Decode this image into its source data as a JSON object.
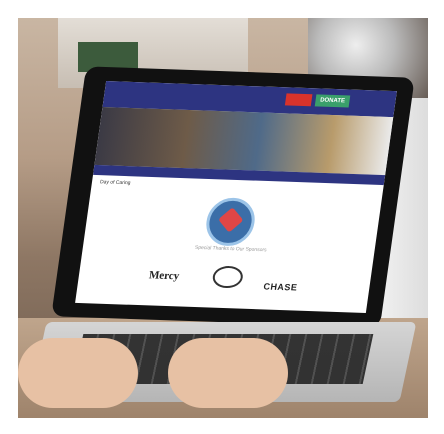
{
  "photo": {
    "subject": "laptop",
    "site": {
      "donate_label": "DONATE",
      "breadcrumb": "Day of Caring",
      "thanks_text": "Special Thanks to Our Sponsors",
      "sponsors": [
        "Mercy",
        "CHASE"
      ]
    }
  }
}
